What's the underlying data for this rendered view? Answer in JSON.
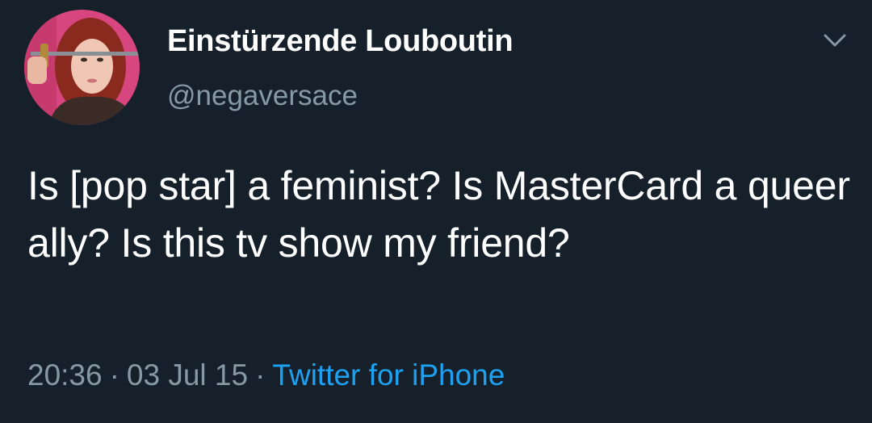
{
  "tweet": {
    "display_name": "Einstürzende Louboutin",
    "handle": "@negaversace",
    "text": "Is [pop star] a feminist? Is MasterCard a queer ally? Is this tv show my friend?",
    "time": "20:36",
    "date": "03 Jul 15",
    "separator": "·",
    "source": "Twitter for iPhone",
    "menu_icon": "chevron-down-icon"
  },
  "colors": {
    "background": "#15202b",
    "primary_text": "#ffffff",
    "secondary_text": "#8899a6",
    "link": "#1da1f2"
  }
}
